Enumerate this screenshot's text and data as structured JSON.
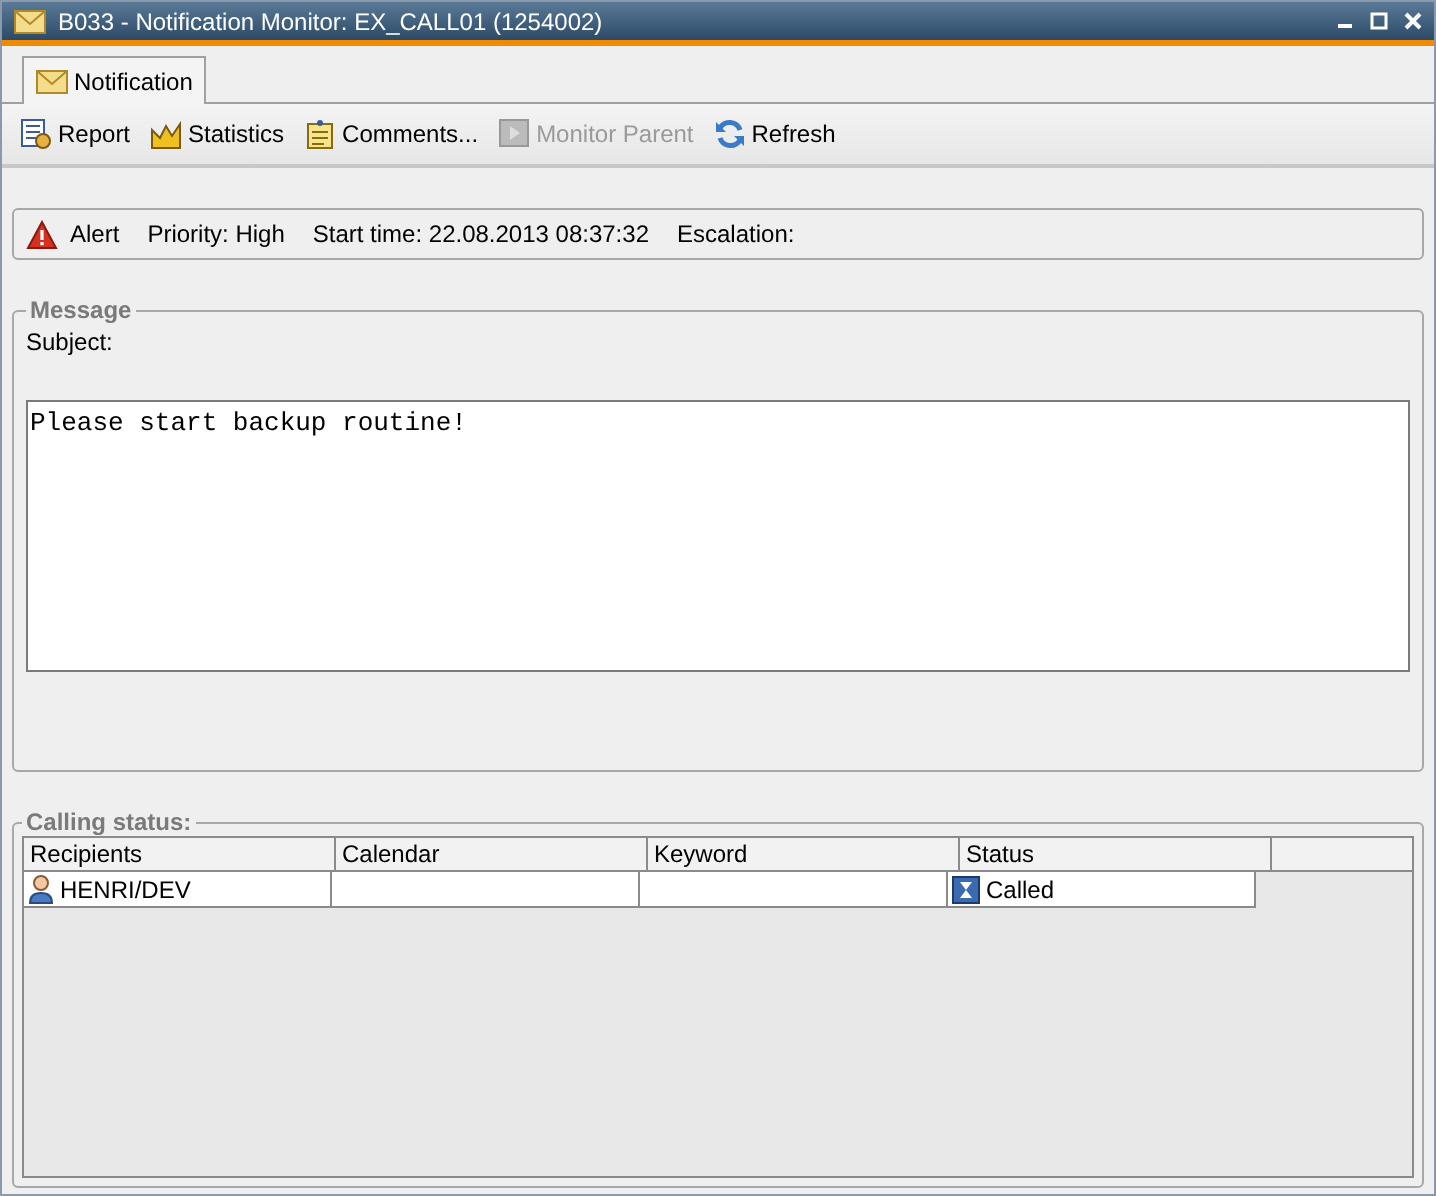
{
  "window": {
    "title": "B033 - Notification Monitor: EX_CALL01 (1254002)"
  },
  "tabs": [
    {
      "label": "Notification",
      "selected": true
    }
  ],
  "toolbar": [
    {
      "label": "Report",
      "disabled": false
    },
    {
      "label": "Statistics",
      "disabled": false
    },
    {
      "label": "Comments...",
      "disabled": false
    },
    {
      "label": "Monitor Parent",
      "disabled": true
    },
    {
      "label": "Refresh",
      "disabled": false
    }
  ],
  "alert_bar": {
    "type": "Alert",
    "priority": "Priority: High",
    "start_time": "Start time: 22.08.2013 08:37:32",
    "escalation": "Escalation:"
  },
  "message": {
    "legend": "Message",
    "subject_label": "Subject:",
    "body": "Please start backup routine!"
  },
  "calling_status": {
    "legend": "Calling status:",
    "columns": [
      "Recipients",
      "Calendar",
      "Keyword",
      "Status"
    ],
    "rows": [
      {
        "cells": [
          "HENRI/DEV",
          "",
          "",
          "Called"
        ]
      }
    ]
  }
}
